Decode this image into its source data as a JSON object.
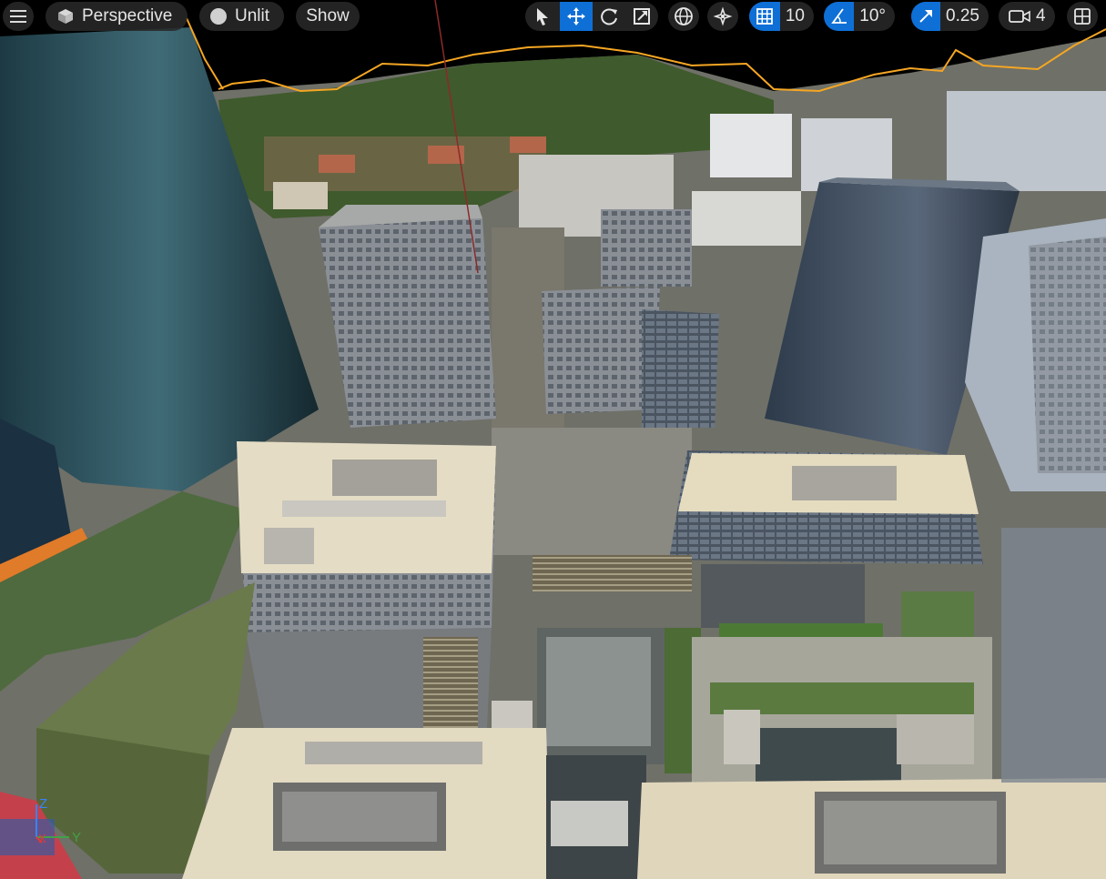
{
  "toolbar": {
    "view_mode": "Perspective",
    "lit_mode": "Unlit",
    "show_label": "Show",
    "grid_snap_value": "10",
    "rotation_snap_value": "10°",
    "scale_snap_value": "0.25",
    "camera_speed_value": "4"
  },
  "axis_gizmo": {
    "z": "Z",
    "x": "X",
    "y": "Y"
  },
  "icons": [
    "menu-icon",
    "perspective-cube-icon",
    "unlit-sphere-icon",
    "select-arrow-icon",
    "translate-icon",
    "rotate-icon",
    "scale-icon",
    "world-globe-icon",
    "surface-snap-icon",
    "grid-snap-icon",
    "angle-snap-icon",
    "scale-snap-icon",
    "camera-icon",
    "layout-icon"
  ],
  "colors": {
    "toolbar_bg": "#282828",
    "active_blue": "#0e6fd6",
    "selection_outline": "#f5a623",
    "axis_z": "#3b82f6",
    "axis_x": "#e53935",
    "axis_y": "#43a047"
  }
}
